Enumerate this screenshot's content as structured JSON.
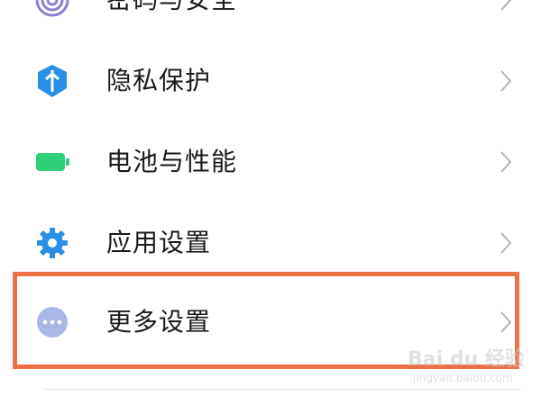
{
  "settings": {
    "items": [
      {
        "label": "密码与安全",
        "icon": "password-security-icon",
        "color": "#8a7fd6"
      },
      {
        "label": "隐私保护",
        "icon": "privacy-shield-icon",
        "color": "#2a8fe6"
      },
      {
        "label": "电池与性能",
        "icon": "battery-icon",
        "color": "#2fd07a"
      },
      {
        "label": "应用设置",
        "icon": "gear-icon",
        "color": "#2a8fe6"
      },
      {
        "label": "更多设置",
        "icon": "more-dots-icon",
        "color": "#a9b7e6"
      }
    ],
    "highlight_color": "#ec7147"
  },
  "watermark": {
    "brand": "Bai du 经验",
    "subtitle": "jingyan.baidu.com"
  }
}
